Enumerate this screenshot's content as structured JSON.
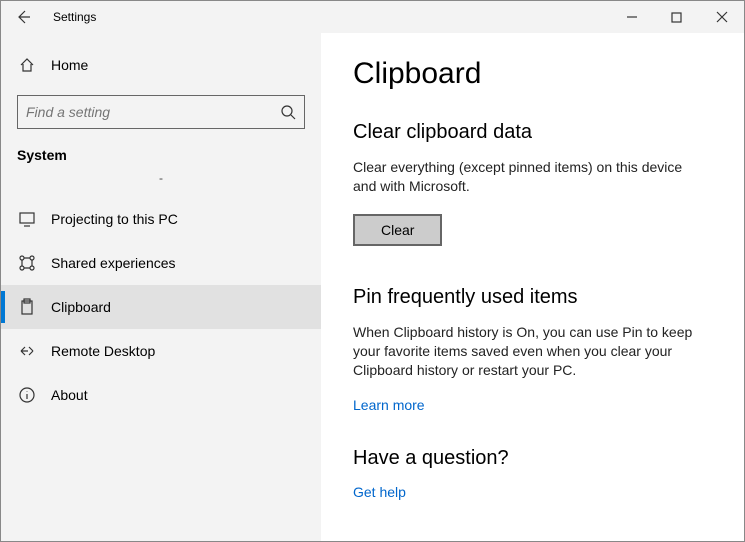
{
  "window": {
    "title": "Settings"
  },
  "sidebar": {
    "home_label": "Home",
    "search_placeholder": "Find a setting",
    "section_label": "System",
    "dash": "-",
    "items": [
      {
        "label": "Projecting to this PC"
      },
      {
        "label": "Shared experiences"
      },
      {
        "label": "Clipboard"
      },
      {
        "label": "Remote Desktop"
      },
      {
        "label": "About"
      }
    ]
  },
  "main": {
    "heading": "Clipboard",
    "section1_title": "Clear clipboard data",
    "section1_desc": "Clear everything (except pinned items) on this device and with Microsoft.",
    "clear_button": "Clear",
    "section2_title": "Pin frequently used items",
    "section2_desc": "When Clipboard history is On, you can use Pin to keep your favorite items saved even when you clear your Clipboard history or restart your PC.",
    "learn_more": "Learn more",
    "question_title": "Have a question?",
    "get_help": "Get help"
  }
}
